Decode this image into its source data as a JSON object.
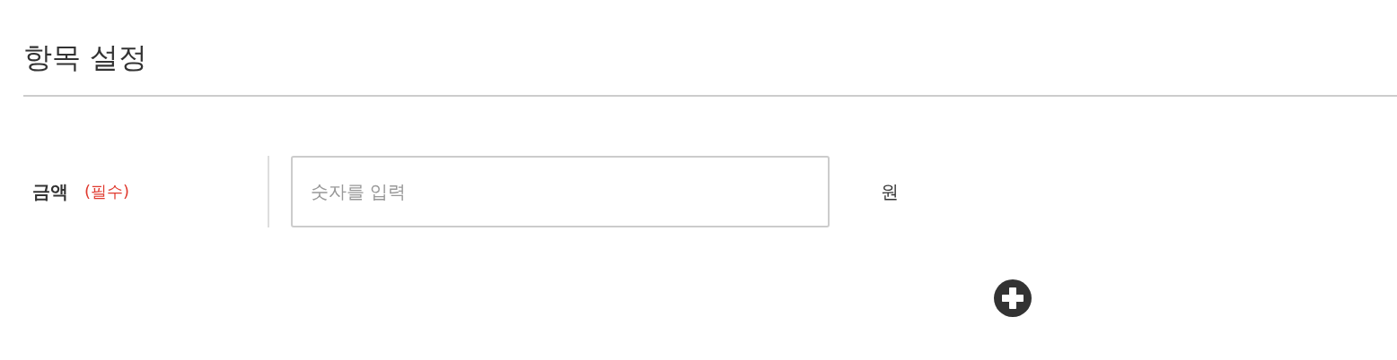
{
  "section_title": "항목 설정",
  "field": {
    "label": "금액",
    "required_note": "(필수)",
    "placeholder": "숫자를 입력",
    "unit": "원"
  }
}
